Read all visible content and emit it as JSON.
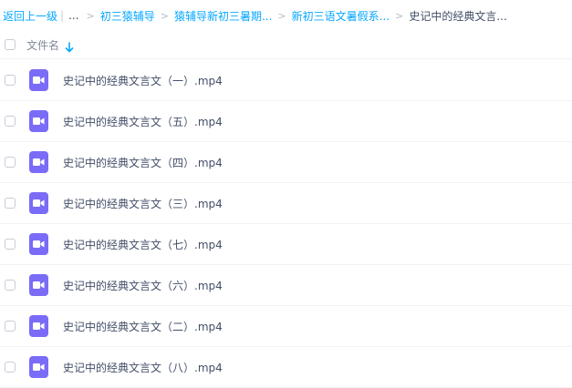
{
  "breadcrumb": {
    "back": "返回上一级",
    "ellipsis": "...",
    "items": [
      "初三猿辅导",
      "猿辅导新初三暑期...",
      "新初三语文暑假系..."
    ],
    "current": "史记中的经典文言...",
    "separator": ">",
    "divider": "|"
  },
  "header": {
    "column_label": "文件名"
  },
  "files": [
    {
      "name": "史记中的经典文言文（一）.mp4"
    },
    {
      "name": "史记中的经典文言文（五）.mp4"
    },
    {
      "name": "史记中的经典文言文（四）.mp4"
    },
    {
      "name": "史记中的经典文言文（三）.mp4"
    },
    {
      "name": "史记中的经典文言文（七）.mp4"
    },
    {
      "name": "史记中的经典文言文（六）.mp4"
    },
    {
      "name": "史记中的经典文言文（二）.mp4"
    },
    {
      "name": "史记中的经典文言文（八）.mp4"
    }
  ],
  "colors": {
    "accent": "#06a7ff",
    "video_icon": "#7a6cf7"
  },
  "icons": {
    "file": "video-file-icon",
    "sort": "sort-arrow-down-icon"
  }
}
